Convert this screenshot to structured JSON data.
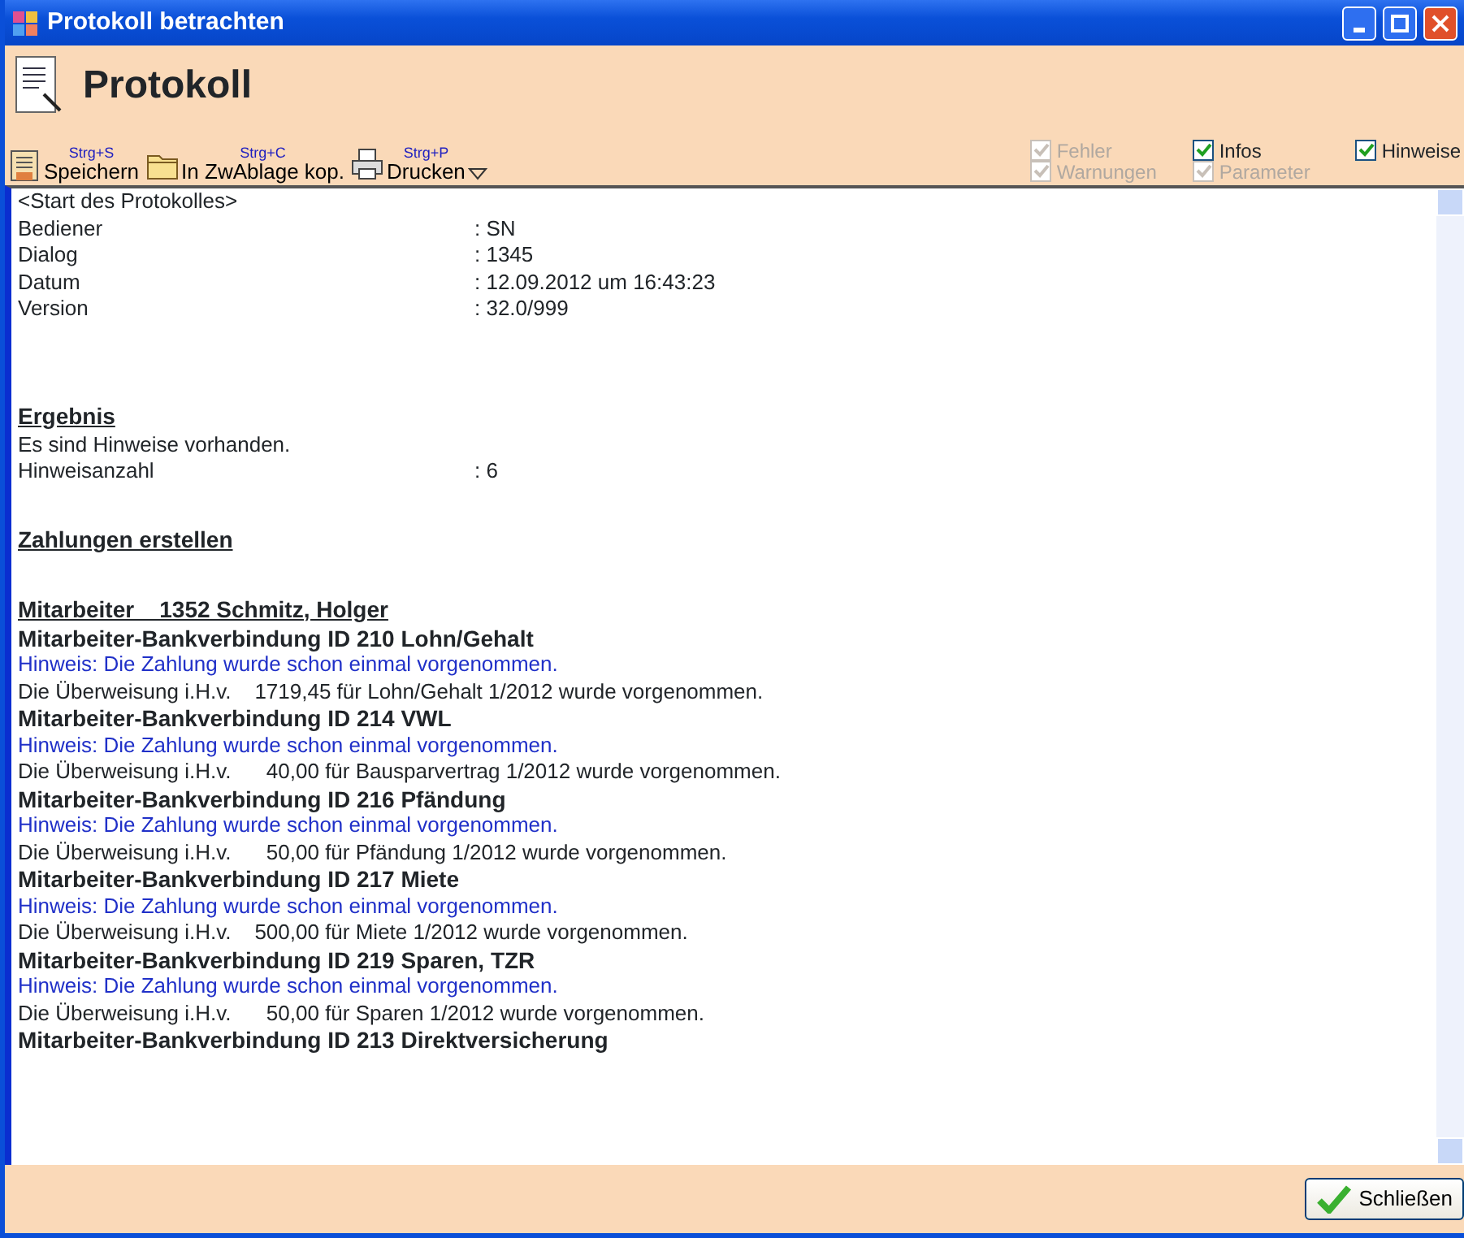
{
  "window": {
    "title": "Protokoll betrachten"
  },
  "header": {
    "title": "Protokoll"
  },
  "toolbar": [
    {
      "kind": "save",
      "shortcut": "Strg+S",
      "label": "Speichern",
      "dropdown": false
    },
    {
      "kind": "copy",
      "shortcut": "Strg+C",
      "label": "In ZwAblage kop.",
      "dropdown": false
    },
    {
      "kind": "print",
      "shortcut": "Strg+P",
      "label": "Drucken",
      "dropdown": true
    }
  ],
  "filters": [
    {
      "label": "Fehler",
      "checked": true,
      "disabled": true
    },
    {
      "label": "Warnungen",
      "checked": true,
      "disabled": true
    },
    {
      "label": "Infos",
      "checked": true,
      "disabled": false
    },
    {
      "label": "Parameter",
      "checked": true,
      "disabled": true
    },
    {
      "label": "Hinweise",
      "checked": true,
      "disabled": false
    }
  ],
  "log": [
    {
      "kind": "plain",
      "text": "<Start des Protokolles>"
    },
    {
      "kind": "field",
      "label": "Bediener",
      "value": ": SN"
    },
    {
      "kind": "field",
      "label": "Dialog",
      "value": ": 1345"
    },
    {
      "kind": "field",
      "label": "Datum",
      "value": ": 12.09.2012 um 16:43:23"
    },
    {
      "kind": "field",
      "label": "Version",
      "value": ": 32.0/999"
    },
    {
      "kind": "blank"
    },
    {
      "kind": "blank"
    },
    {
      "kind": "heading",
      "text": "Ergebnis"
    },
    {
      "kind": "plain",
      "text": "Es sind Hinweise vorhanden."
    },
    {
      "kind": "field",
      "label": "Hinweisanzahl",
      "value": ": 6"
    },
    {
      "kind": "blank"
    },
    {
      "kind": "heading",
      "text": "Zahlungen erstellen"
    },
    {
      "kind": "blank"
    },
    {
      "kind": "heading",
      "text": "Mitarbeiter    1352 Schmitz, Holger"
    },
    {
      "kind": "bold",
      "text": "Mitarbeiter-Bankverbindung ID 210 Lohn/Gehalt"
    },
    {
      "kind": "hint",
      "text": "Hinweis: Die Zahlung wurde schon einmal vorgenommen."
    },
    {
      "kind": "plain",
      "text": "Die Überweisung i.H.v.    1719,45 für Lohn/Gehalt 1/2012 wurde vorgenommen."
    },
    {
      "kind": "bold",
      "text": "Mitarbeiter-Bankverbindung ID 214 VWL"
    },
    {
      "kind": "hint",
      "text": "Hinweis: Die Zahlung wurde schon einmal vorgenommen."
    },
    {
      "kind": "plain",
      "text": "Die Überweisung i.H.v.      40,00 für Bausparvertrag 1/2012 wurde vorgenommen."
    },
    {
      "kind": "bold",
      "text": "Mitarbeiter-Bankverbindung ID 216 Pfändung"
    },
    {
      "kind": "hint",
      "text": "Hinweis: Die Zahlung wurde schon einmal vorgenommen."
    },
    {
      "kind": "plain",
      "text": "Die Überweisung i.H.v.      50,00 für Pfändung 1/2012 wurde vorgenommen."
    },
    {
      "kind": "bold",
      "text": "Mitarbeiter-Bankverbindung ID 217 Miete"
    },
    {
      "kind": "hint",
      "text": "Hinweis: Die Zahlung wurde schon einmal vorgenommen."
    },
    {
      "kind": "plain",
      "text": "Die Überweisung i.H.v.    500,00 für Miete 1/2012 wurde vorgenommen."
    },
    {
      "kind": "bold",
      "text": "Mitarbeiter-Bankverbindung ID 219 Sparen, TZR"
    },
    {
      "kind": "hint",
      "text": "Hinweis: Die Zahlung wurde schon einmal vorgenommen."
    },
    {
      "kind": "plain",
      "text": "Die Überweisung i.H.v.      50,00 für Sparen 1/2012 wurde vorgenommen."
    },
    {
      "kind": "bold",
      "text": "Mitarbeiter-Bankverbindung ID 213 Direktversicherung"
    }
  ],
  "close_button": {
    "label": "Schließen"
  }
}
